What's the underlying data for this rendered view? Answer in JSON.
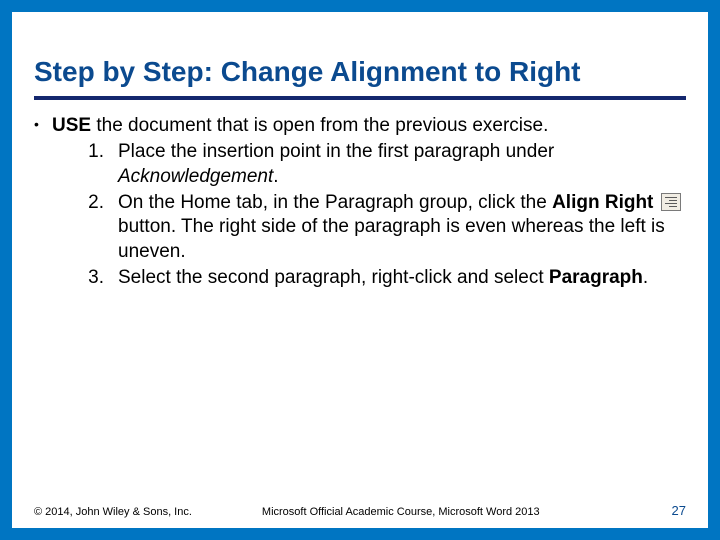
{
  "title": "Step by Step: Change Alignment to Right",
  "bullet": {
    "lead_bold": "USE",
    "lead_rest": " the document that is open from the previous exercise."
  },
  "steps": [
    {
      "num": "1.",
      "pre": "Place the insertion point in the first paragraph under ",
      "em": "Acknowledgement",
      "post": "."
    },
    {
      "num": "2.",
      "pre": "On the Home tab, in the Paragraph group, click the ",
      "bold": "Align Right",
      "post_icon": " button. The right side of the paragraph is even whereas the left is uneven."
    },
    {
      "num": "3.",
      "pre": "Select the second paragraph, right-click and select ",
      "bold": "Paragraph",
      "post": "."
    }
  ],
  "footer": {
    "left": "© 2014, John Wiley & Sons, Inc.",
    "center": "Microsoft Official Academic Course, Microsoft Word 2013",
    "right": "27"
  }
}
